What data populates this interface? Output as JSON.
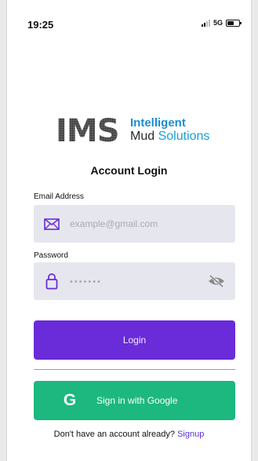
{
  "status_bar": {
    "time": "19:25",
    "network": "5G",
    "battery_level": 0.6
  },
  "logo": {
    "mark": "IMS",
    "line1": "Intelligent",
    "line2_prefix": "Mud",
    "line2_accent": "Solutions"
  },
  "title": "Account Login",
  "email": {
    "label": "Email Address",
    "placeholder": "example@gmail.com",
    "value": "",
    "icon": "envelope-icon"
  },
  "password": {
    "label": "Password",
    "placeholder": "•••••••",
    "value": "",
    "icon": "lock-icon",
    "toggle_icon": "eye-off-icon"
  },
  "login_button": {
    "label": "Login"
  },
  "google_button": {
    "label": "Sign in with Google",
    "icon_glyph": "G"
  },
  "signup": {
    "prompt": "Don't have an account already?",
    "link": "Signup"
  },
  "colors": {
    "primary": "#6a2bd9",
    "google_green": "#1cb880",
    "logo_blue": "#1a8ed0",
    "input_bg": "#e6e7ee"
  }
}
